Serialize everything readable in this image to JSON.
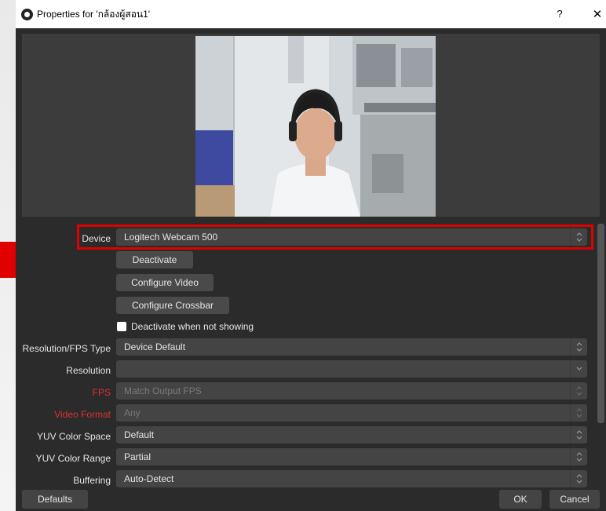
{
  "window": {
    "title": "Properties for 'กล้องผู้สอน1'",
    "help_label": "?",
    "close_label": "✕"
  },
  "properties": {
    "device": {
      "label": "Device",
      "value": "Logitech Webcam 500"
    },
    "buttons": {
      "deactivate": "Deactivate",
      "configure_video": "Configure Video",
      "configure_crossbar": "Configure Crossbar"
    },
    "deactivate_when_not_showing": {
      "label": "Deactivate when not showing",
      "checked": false
    },
    "resolution_fps_type": {
      "label": "Resolution/FPS Type",
      "value": "Device Default"
    },
    "resolution": {
      "label": "Resolution",
      "value": ""
    },
    "fps": {
      "label": "FPS",
      "value": "Match Output FPS"
    },
    "video_format": {
      "label": "Video Format",
      "value": "Any"
    },
    "yuv_color_space": {
      "label": "YUV Color Space",
      "value": "Default"
    },
    "yuv_color_range": {
      "label": "YUV Color Range",
      "value": "Partial"
    },
    "buffering": {
      "label": "Buffering",
      "value": "Auto-Detect"
    }
  },
  "footer": {
    "defaults": "Defaults",
    "ok": "OK",
    "cancel": "Cancel"
  },
  "colors": {
    "window_bg": "#2b2b2b",
    "field_bg": "#444444",
    "highlight": "#e00000",
    "annotation_arrow": "#e00000",
    "disabled_label": "#e03030"
  },
  "icons": {
    "app": "obs-logo-icon",
    "annotation": "arrow-right-icon",
    "combo_updown": "chevron-updown-icon",
    "combo_down": "chevron-down-icon"
  }
}
